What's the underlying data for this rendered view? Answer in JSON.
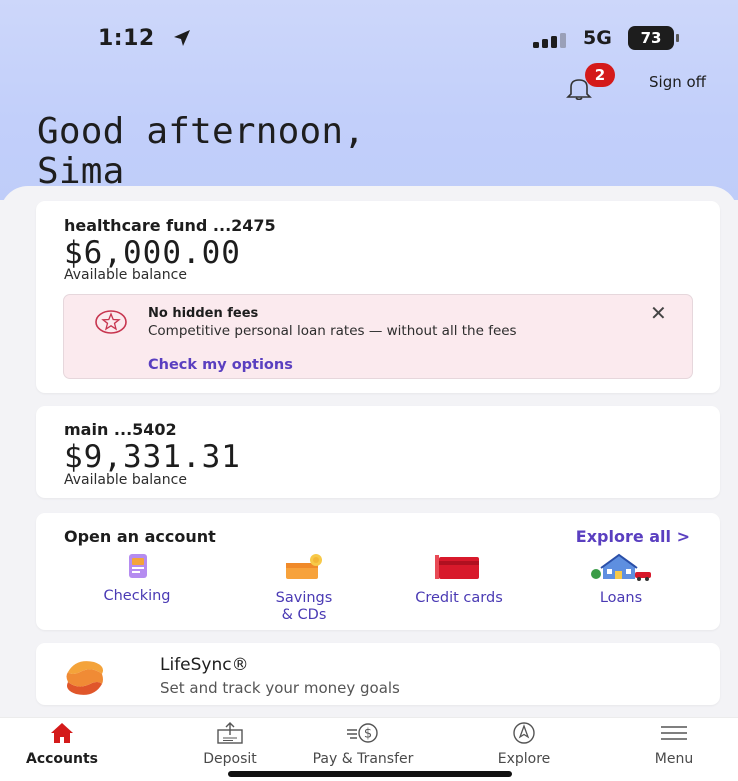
{
  "status": {
    "time": "1:12",
    "network": "5G",
    "battery": "73"
  },
  "header": {
    "notification_count": "2",
    "signoff_label": "Sign off",
    "greeting_line1": "Good afternoon,",
    "greeting_line2": "Sima"
  },
  "accounts": [
    {
      "name": "healthcare fund ...2475",
      "balance": "$6,000.00",
      "balance_label": "Available balance"
    },
    {
      "name": "main ...5402",
      "balance": "$9,331.31",
      "balance_label": "Available balance"
    }
  ],
  "promo": {
    "title": "No hidden fees",
    "text": "Competitive personal loan rates — without all the fees",
    "link": "Check my options"
  },
  "open_account": {
    "title": "Open an account",
    "explore_all": "Explore all  >",
    "products": [
      {
        "label_line1": "Checking",
        "label_line2": ""
      },
      {
        "label_line1": "Savings",
        "label_line2": "& CDs"
      },
      {
        "label_line1": "Credit cards",
        "label_line2": ""
      },
      {
        "label_line1": "Loans",
        "label_line2": ""
      }
    ]
  },
  "lifesync": {
    "title": "LifeSync®",
    "subtitle": "Set and track your money goals"
  },
  "tabs": [
    {
      "label": "Accounts",
      "icon": "home-icon"
    },
    {
      "label": "Deposit",
      "icon": "deposit-icon"
    },
    {
      "label": "Pay & Transfer",
      "icon": "pay-transfer-icon"
    },
    {
      "label": "Explore",
      "icon": "compass-icon"
    },
    {
      "label": "Menu",
      "icon": "menu-icon"
    }
  ],
  "colors": {
    "accent": "#5a3fc0",
    "brand_red": "#d41a1a",
    "header_bg": "#c2cffa",
    "promo_bg": "#fbeaee"
  }
}
